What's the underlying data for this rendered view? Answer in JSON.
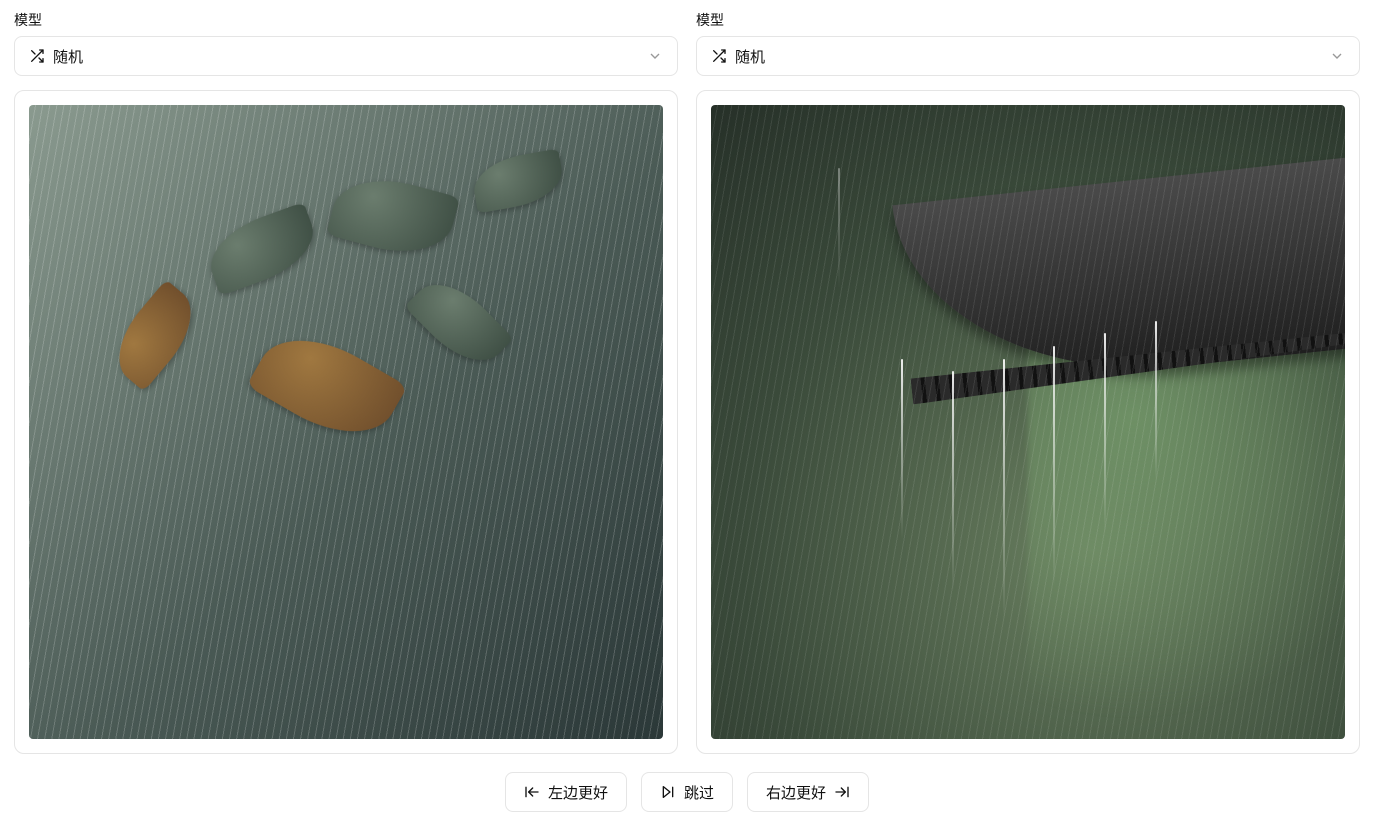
{
  "left": {
    "label": "模型",
    "select_value": "随机",
    "image_desc": "rain-on-leaves"
  },
  "right": {
    "label": "模型",
    "select_value": "随机",
    "image_desc": "rain-on-traditional-roof"
  },
  "actions": {
    "left_better": "左边更好",
    "skip": "跳过",
    "right_better": "右边更好"
  }
}
